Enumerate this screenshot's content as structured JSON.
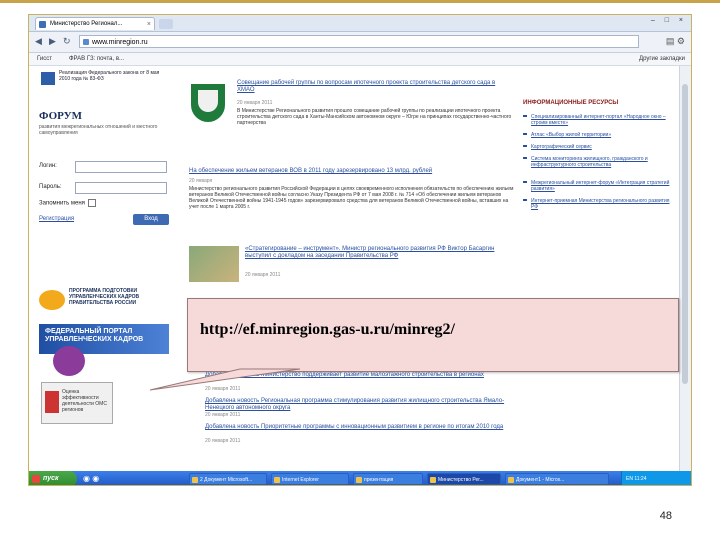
{
  "browser": {
    "tab_title": "Министерство Регионал...",
    "address": "www.minregion.ru",
    "bookmarks": [
      {
        "label": "Гисст"
      },
      {
        "label": "ФРАВ ГЗ: почта, в..."
      }
    ],
    "bookmarks_other": "Другие закладки",
    "window_controls": "– □ ×"
  },
  "page": {
    "left": {
      "banner_text": "Реализация Федерального закона от 8 мая 2010 года № 83-ФЗ",
      "forum_title": "ФОРУМ",
      "forum_subtitle": "развития межрегиональных отношений и местного самоуправления",
      "login_label": "Логин:",
      "password_label": "Пароль:",
      "remember_label": "Запомнить меня",
      "register_link": "Регистрация",
      "enter_button": "Вход",
      "promo1": "ПРОГРАММА ПОДГОТОВКИ УПРАВЛЕНЧЕСКИХ КАДРОВ ПРАВИТЕЛЬСТВА РОССИИ",
      "promo2": "ФЕДЕРАЛЬНЫЙ ПОРТАЛ УПРАВЛЕНЧЕСКИХ КАДРОВ",
      "promo4": "Оценка эффективности деятельности ОМС регионов"
    },
    "news": [
      {
        "title": "Совещание рабочей группы по вопросам ипотечного проекта строительства детского сада в ХМАО",
        "date": "20 января 2011",
        "text": "В Министерстве Регионального развития прошло совещание рабочей группы по реализации ипотечного проекта строительства детского сада в Ханты-Мансийском автономном округе – Югре на принципах государственно-частного партнерства"
      },
      {
        "title": "На обеспечение жильем ветеранов ВОВ в 2011 году зарезервировано 13 млрд. рублей",
        "date": "20 января",
        "text": "Министерство регионального развития Российской Федерации в целях своевременного исполнения обязательств по обеспечению жильем ветеранов Великой Отечественной войны согласно Указу Президента РФ от 7 мая 2008 г. № 714 «Об обеспечении жильем ветеранов Великой Отечественной войны 1941-1945 годов» зарезервировало средства для ветеранов Великой Отечественной войны, вставших на учет после 1 марта 2005 г."
      },
      {
        "title": "«Стратегирование – инструмент». Министр регионального развития РФ Виктор Басаргин выступил с докладом на заседании Правительства РФ",
        "date": "20 января 2011"
      },
      {
        "title": "Добавлена новость Министерство поддерживает развитие малоэтажного строительства в регионах",
        "date": "20 января 2011"
      },
      {
        "title": "Добавлена новость Региональная программа стимулирования развития жилищного строительства Ямало-Ненецкого автономного округа",
        "date": "20 января 2011"
      },
      {
        "title": "Добавлена новость Приоритетные программы с инновационным развитием в регионе по итогам 2010 года",
        "date": "20 января 2011"
      }
    ],
    "right": {
      "title": "ИНФОРМАЦИОННЫЕ РЕСУРСЫ",
      "items": [
        "Специализированный интернет-портал «Народное окно – строим вместе»",
        "Атлас «Выбор жилой территории»",
        "Картографический сервис",
        "Система мониторинга жилищного, гражданского и инфраструктурного строительства",
        "Межрегиональный интернет-форум «Интеграция стратегий развития»",
        "Интернет-приемная Министерства регионального развития РФ"
      ]
    }
  },
  "callout": {
    "url": "http://ef.minregion.gas-u.ru/minreg2/"
  },
  "taskbar": {
    "start_label": "пуск",
    "tasks": [
      "2 Документ Microsoft...",
      "Internet Explorer",
      "презентация",
      "Министерство Рег...",
      "Документ1 - Micros..."
    ],
    "tray": "EN  11:24"
  },
  "slide_number": "48"
}
